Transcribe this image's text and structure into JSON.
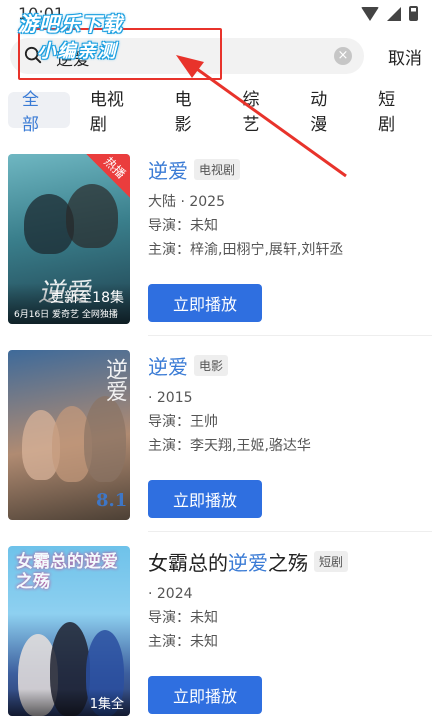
{
  "status_bar": {
    "time": "10:01"
  },
  "watermark": {
    "line1": "游吧乐下载",
    "line2": "小编亲测"
  },
  "search": {
    "query": "逆爱",
    "cancel_label": "取消"
  },
  "tabs": [
    {
      "label": "全部",
      "active": true
    },
    {
      "label": "电视剧",
      "active": false
    },
    {
      "label": "电影",
      "active": false
    },
    {
      "label": "综艺",
      "active": false
    },
    {
      "label": "动漫",
      "active": false
    },
    {
      "label": "短剧",
      "active": false
    }
  ],
  "results": [
    {
      "title_prefix": "",
      "title_highlight": "逆爱",
      "title_suffix": "",
      "type": "电视剧",
      "region_year": "大陆 · 2025",
      "director": "导演：未知",
      "cast": "主演：梓渝,田栩宁,展轩,刘轩丞",
      "badge": "热播",
      "poster_caption": "更新至18集",
      "poster_date": "6月16日 爱奇艺 全网独播",
      "play_label": "立即播放"
    },
    {
      "title_prefix": "",
      "title_highlight": "逆爱",
      "title_suffix": "",
      "type": "电影",
      "region_year": "· 2015",
      "director": "导演：王帅",
      "cast": "主演：李天翔,王姬,骆达华",
      "poster_art": "逆爱",
      "poster_score": "8.1",
      "play_label": "立即播放"
    },
    {
      "title_prefix": "女霸总的",
      "title_highlight": "逆爱",
      "title_suffix": "之殇",
      "type": "短剧",
      "region_year": "· 2024",
      "director": "导演：未知",
      "cast": "主演：未知",
      "poster_art": "女霸总的逆爱之殇",
      "poster_caption": "1集全",
      "play_label": "立即播放"
    }
  ],
  "colors": {
    "accent": "#3a7bd5",
    "button": "#2f6fe0",
    "annotation": "#e8332b"
  }
}
